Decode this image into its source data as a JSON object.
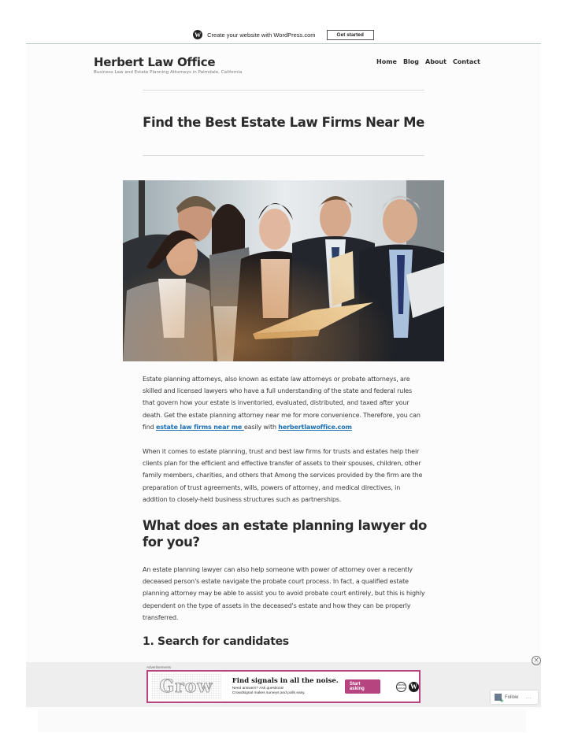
{
  "wp_banner": {
    "message": "Create your website with WordPress.com",
    "cta": "Get started",
    "logo_icon": "wordpress-logo-icon"
  },
  "site": {
    "title": "Herbert Law Office",
    "description": "Business Law and Estate Planning Attorneys in Palmdale, California"
  },
  "nav": {
    "items": [
      {
        "label": "Home"
      },
      {
        "label": "Blog"
      },
      {
        "label": "About"
      },
      {
        "label": "Contact"
      }
    ]
  },
  "post": {
    "title": "Find the Best Estate Law Firms Near Me",
    "hero_alt": "Group of business professionals reviewing documents in a folder",
    "p1": {
      "text_before": "Estate planning attorneys, also known as estate law attorneys or probate attorneys, are skilled and licensed lawyers who have a full understanding of the state and federal rules that govern how your estate is inventoried, evaluated, distributed, and taxed after your death. Get the estate planning attorney near me for more convenience. Therefore, you can find ",
      "link1": "estate law firms near me ",
      "text_middle": "easily with ",
      "link2": "herbertlawoffice.com"
    },
    "p2": " When it comes to estate planning, trust and best law firms for trusts and estates help their clients plan for the efficient and effective transfer of assets to their spouses, children, other family members, charities, and others that Among the services provided by the firm are the preparation of trust agreements, wills, powers of attorney, and medical directives, in addition to closely-held business structures such as partnerships.",
    "h2": "What does an estate planning lawyer do for you?",
    "p3": "An estate planning lawyer can also help someone with power of attorney over a recently deceased person's estate navigate the probate court process. In fact, a qualified estate planning attorney may be able to assist you to avoid probate court entirely, but this is highly dependent on the type of assets in the deceased's estate and how they can be properly transferred.",
    "h3": "1. Search for candidates"
  },
  "ad": {
    "label": "Advertisements",
    "brand_word": "Grow",
    "headline": "Find signals in all the noise.",
    "subline1": "Need answers? Ask questions!",
    "subline2": "Crowdsignal makes surveys and polls easy.",
    "cta": "Start asking",
    "logo1": "CROWD SIGNAL",
    "logo2": "W",
    "accent_color": "#b5447f"
  },
  "widgets": {
    "close_icon": "close-circle-icon",
    "follow_label": "Follow",
    "more_label": "..."
  }
}
